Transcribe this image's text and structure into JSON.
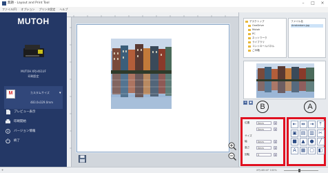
{
  "titlebar": {
    "title": "無題 - Layout and Print Tool",
    "minimize": "–",
    "maximize": "□",
    "close": "×"
  },
  "menu": [
    "ファイル(F)",
    "オプション",
    "プリンタ設定",
    "ヘルプ"
  ],
  "nav": {
    "logo": "MUTOH",
    "printer_name": "MUTOH XPJ-461UF",
    "printer_status": "印刷設定",
    "media": {
      "icon_letter": "M",
      "type": "カスタムサイズ",
      "size": "483.0x329.0mm"
    },
    "items": [
      {
        "icon": "document-icon",
        "label": "プレビュー表示"
      },
      {
        "icon": "print-icon",
        "label": "印刷開始"
      },
      {
        "icon": "info-icon",
        "label": "バージョン情報"
      },
      {
        "icon": "power-icon",
        "label": "終了"
      }
    ]
  },
  "file_browser": {
    "tree": [
      "デスクトップ",
      "OneDrive",
      "Mutoh",
      "PC",
      "ネットワーク",
      "ライブラリ",
      "コントロールパネル",
      "ごみ箱"
    ],
    "file_header": "ファイル名",
    "selected_file": "Amsterdam.jpg"
  },
  "labels": {
    "b": "B",
    "a": "A"
  },
  "properties": {
    "rows": [
      {
        "label": "位置",
        "value": "0mm"
      },
      {
        "label": "",
        "value": "0mm"
      },
      {
        "label": "サイズ",
        "value": ""
      },
      {
        "label": "幅",
        "value": "0mm"
      },
      {
        "label": "高さ",
        "value": "0mm"
      },
      {
        "label": "回転",
        "value": "0"
      }
    ]
  },
  "tools": [
    {
      "name": "align-left-tool",
      "glyph": "⇤"
    },
    {
      "name": "align-center-tool",
      "glyph": "⇹"
    },
    {
      "name": "align-right-tool",
      "glyph": "⇥"
    },
    {
      "name": "align-top-tool",
      "glyph": "⤒"
    },
    {
      "name": "image-tool",
      "glyph": "▣"
    },
    {
      "name": "picture-tool",
      "glyph": "▤"
    },
    {
      "name": "picture-alt-tool",
      "glyph": "▥"
    },
    {
      "name": "crop-tool",
      "glyph": "✂"
    },
    {
      "name": "rectangle-tool",
      "glyph": "■"
    },
    {
      "name": "triangle-tool",
      "glyph": "▲"
    },
    {
      "name": "ellipse-tool",
      "glyph": "●"
    },
    {
      "name": "line-tool",
      "glyph": "╱"
    },
    {
      "name": "text-tool",
      "glyph": "A"
    },
    {
      "name": "qr-code-tool",
      "glyph": "▦"
    },
    {
      "name": "rounded-rect-tool",
      "glyph": "▢"
    },
    {
      "name": "fill-tool",
      "glyph": "◧"
    }
  ],
  "status": {
    "left": "+",
    "right": "XPJ-461UF  100%"
  }
}
